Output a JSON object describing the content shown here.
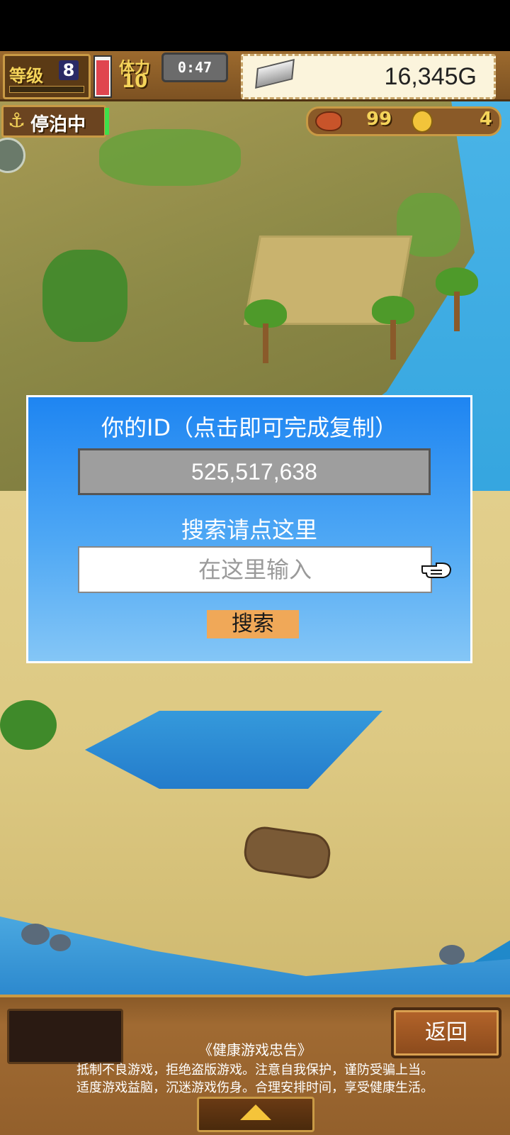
{
  "hud": {
    "level_label": "等级",
    "level_value": "8",
    "stamina_label": "体力",
    "stamina_value": "10",
    "stamina_fill_fraction": 0.95,
    "timer": "0:47",
    "gold": "16,345G",
    "status_label": "停泊中",
    "food_count": "99",
    "medal_count": "4"
  },
  "dialog": {
    "title": "你的ID（点击即可完成复制）",
    "id_value": "525,517,638",
    "search_label": "搜索请点这里",
    "input_placeholder": "在这里输入",
    "input_value": "",
    "search_button": "搜索"
  },
  "bottom": {
    "return_button": "返回",
    "advisory_title": "《健康游戏忠告》",
    "advisory_line1": "抵制不良游戏，拒绝盗版游戏。注意自我保护，谨防受骗上当。",
    "advisory_line2": "适度游戏益脑，沉迷游戏伤身。合理安排时间，享受健康生活。"
  },
  "icons": {
    "anchor": "anchor-icon",
    "silver_bar": "silver-bar-icon",
    "meat": "meat-icon",
    "medal": "medal-icon",
    "pointing_hand": "pointing-hand-icon",
    "up_arrow": "up-arrow-icon"
  },
  "colors": {
    "dialog_top": "#1e85f2",
    "dialog_bottom": "#84c6f6",
    "search_button": "#f0a858",
    "hud_gold_text": "#f5d45a",
    "stamina_red": "#e0454f"
  }
}
